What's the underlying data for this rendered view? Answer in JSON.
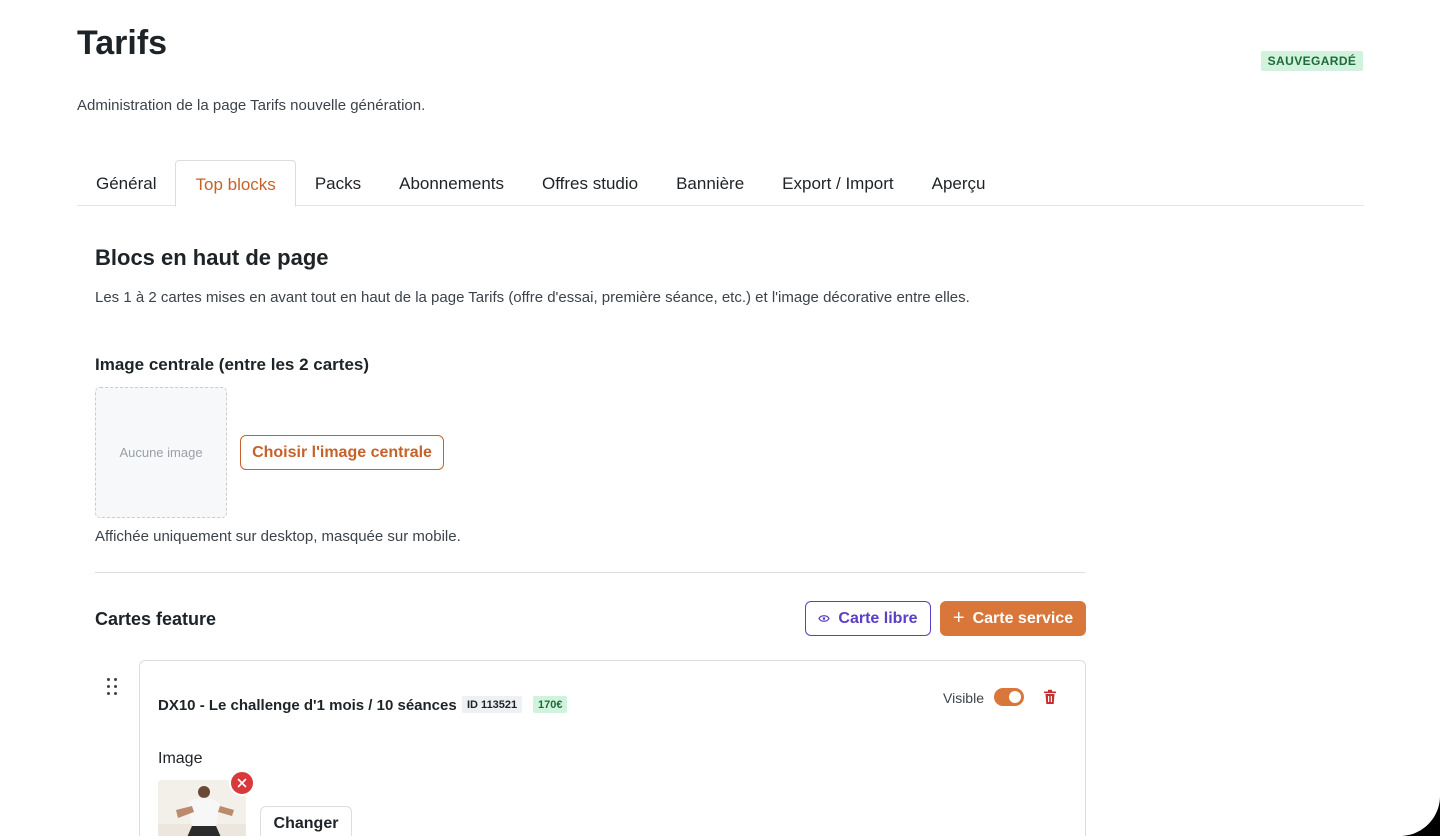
{
  "page": {
    "title": "Tarifs",
    "subtitle": "Administration de la page Tarifs nouvelle génération.",
    "status_badge": "SAUVEGARDÉ"
  },
  "tabs": [
    {
      "label": "Général",
      "active": false
    },
    {
      "label": "Top blocks",
      "active": true
    },
    {
      "label": "Packs",
      "active": false
    },
    {
      "label": "Abonnements",
      "active": false
    },
    {
      "label": "Offres studio",
      "active": false
    },
    {
      "label": "Bannière",
      "active": false
    },
    {
      "label": "Export / Import",
      "active": false
    },
    {
      "label": "Aperçu",
      "active": false
    }
  ],
  "section": {
    "title": "Blocs en haut de page",
    "description": "Les 1 à 2 cartes mises en avant tout en haut de la page Tarifs (offre d'essai, première séance, etc.) et l'image décorative entre elles."
  },
  "central_image": {
    "heading": "Image centrale (entre les 2 cartes)",
    "placeholder": "Aucune image",
    "choose_label": "Choisir l'image centrale",
    "note": "Affichée uniquement sur desktop, masquée sur mobile."
  },
  "feature_cards": {
    "heading": "Cartes feature",
    "free_card_label": "Carte libre",
    "service_card_label": "Carte service",
    "items": [
      {
        "title": "DX10 - Le challenge d'1 mois / 10 séances",
        "id_label": "ID 113521",
        "price": "170€",
        "visible_label": "Visible",
        "visible": true,
        "image_label": "Image",
        "change_label": "Changer"
      }
    ]
  },
  "colors": {
    "accent": "#d9773a",
    "accent_text": "#c5622b",
    "secondary": "#5b3fc4",
    "success_bg": "#d1f2dc",
    "success_text": "#1e6b3a",
    "danger": "#d8393c"
  },
  "icons": {
    "free_card": "eye-icon",
    "service_card": "plus-icon",
    "drag": "drag-handle-icon",
    "delete": "trash-icon",
    "remove_image": "close-icon"
  }
}
